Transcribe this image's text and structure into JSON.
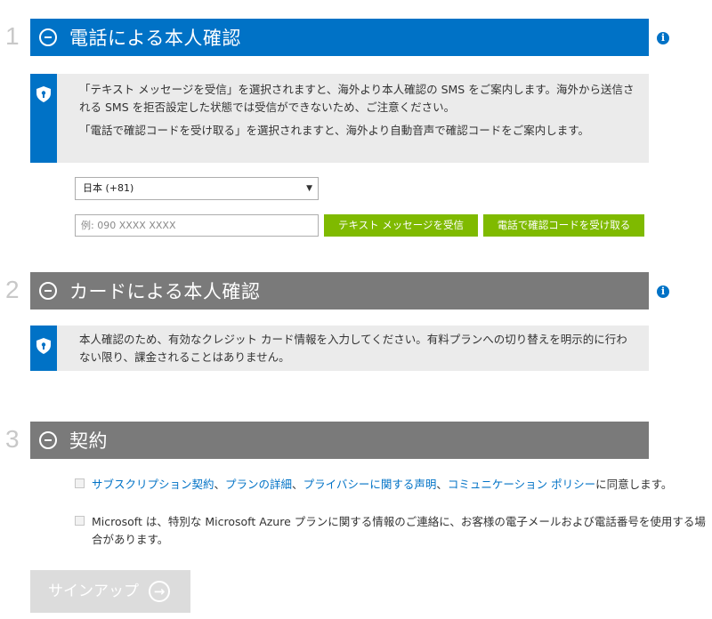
{
  "step1": {
    "number": "1",
    "title": "電話による本人確認",
    "info_icon": "info-icon",
    "notice": [
      "「テキスト メッセージを受信」を選択されますと、海外より本人確認の SMS をご案内します。海外から送信される SMS を拒否設定した状態では受信ができないため、ご注意ください。",
      "「電話で確認コードを受け取る」を選択されますと、海外より自動音声で確認コードをご案内します。"
    ],
    "country_select": "日本 (+81)",
    "phone_placeholder": "例: 090 XXXX XXXX",
    "text_button": "テキスト メッセージを受信",
    "call_button": "電話で確認コードを受け取る"
  },
  "step2": {
    "number": "2",
    "title": "カードによる本人確認",
    "notice": "本人確認のため、有効なクレジット カード情報を入力してください。有料プランへの切り替えを明示的に行わない限り、課金されることはありません。"
  },
  "step3": {
    "number": "3",
    "title": "契約",
    "agree1": {
      "link_subscription": "サブスクリプション契約",
      "sep1": "、",
      "link_offer": "プランの詳細",
      "sep2": "、",
      "link_privacy": "プライバシーに関する声明",
      "sep3": "、",
      "link_comm": "コミュニケーション ポリシー",
      "suffix": "に同意します。"
    },
    "agree2": "Microsoft は、特別な Microsoft Azure プランに関する情報のご連絡に、お客様の電子メールおよび電話番号を使用する場合があります。"
  },
  "signup_label": "サインアップ",
  "colors": {
    "accent_blue": "#0072c6",
    "green": "#7fba00",
    "grey_bar": "#7a7a7a"
  }
}
